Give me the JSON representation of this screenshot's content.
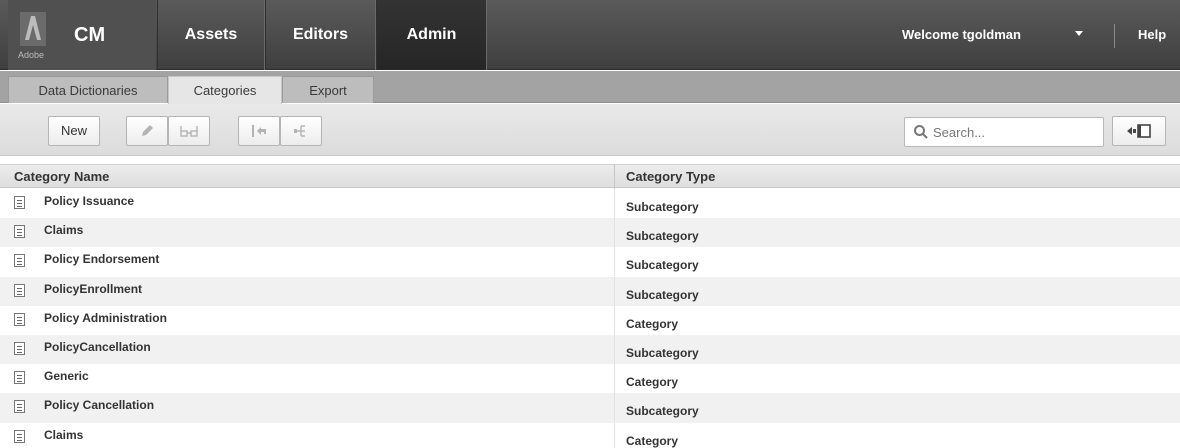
{
  "brand": {
    "logo_word": "Adobe",
    "app_name": "CM"
  },
  "nav": {
    "tabs": [
      {
        "label": "Assets"
      },
      {
        "label": "Editors"
      },
      {
        "label": "Admin"
      }
    ]
  },
  "user": {
    "welcome": "Welcome tgoldman",
    "help": "Help"
  },
  "subtabs": [
    {
      "label": "Data Dictionaries"
    },
    {
      "label": "Categories"
    },
    {
      "label": "Export"
    }
  ],
  "toolbar": {
    "new_label": "New",
    "icons": {
      "edit": "pencil-icon",
      "preview": "glasses-icon",
      "revert": "revert-icon",
      "hierarchy": "hierarchy-icon",
      "panel": "panel-toggle-icon"
    }
  },
  "search": {
    "placeholder": "Search..."
  },
  "table": {
    "columns": [
      "Category Name",
      "Category Type"
    ],
    "rows": [
      {
        "name": "Policy Issuance",
        "type": "Subcategory"
      },
      {
        "name": "Claims",
        "type": "Subcategory"
      },
      {
        "name": "Policy Endorsement",
        "type": "Subcategory"
      },
      {
        "name": "PolicyEnrollment",
        "type": "Subcategory"
      },
      {
        "name": "Policy Administration",
        "type": "Category"
      },
      {
        "name": "PolicyCancellation",
        "type": "Subcategory"
      },
      {
        "name": "Generic",
        "type": "Category"
      },
      {
        "name": "Policy Cancellation",
        "type": "Subcategory"
      },
      {
        "name": "Claims",
        "type": "Category"
      }
    ]
  },
  "colors": {
    "topbar": "#4a4a4a",
    "active_tab": "#2e2e2e",
    "subbar": "#a3a3a3",
    "row_alt": "#f1f1f1"
  }
}
